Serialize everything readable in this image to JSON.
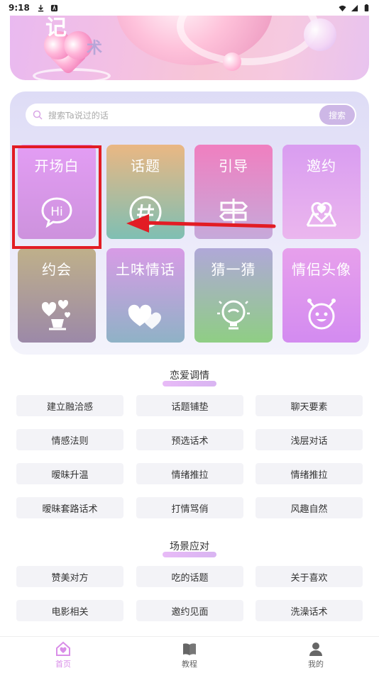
{
  "status_bar": {
    "time": "9:18"
  },
  "banner": {
    "glyph1": "记",
    "glyph2": "术"
  },
  "search": {
    "placeholder": "搜索Ta说过的话",
    "button": "搜索"
  },
  "tiles": [
    {
      "label": "开场白",
      "icon": "hi-bubble-icon",
      "color_top": "#e19cf3",
      "color_bottom": "#cf93df"
    },
    {
      "label": "话题",
      "icon": "hashtag-icon",
      "color_top": "#e8b783",
      "color_bottom": "#7fbfb3"
    },
    {
      "label": "引导",
      "icon": "signpost-icon",
      "color_top": "#f080c0",
      "color_bottom": "#c9a7d9"
    },
    {
      "label": "邀约",
      "icon": "map-heart-icon",
      "color_top": "#d99ff0",
      "color_bottom": "#e9b4ee"
    },
    {
      "label": "约会",
      "icon": "hearts-cup-icon",
      "color_top": "#bfb08c",
      "color_bottom": "#9d8aa8"
    },
    {
      "label": "土味情话",
      "icon": "two-hearts-icon",
      "color_top": "#d69be6",
      "color_bottom": "#92b0c6"
    },
    {
      "label": "猜一猜",
      "icon": "lightbulb-icon",
      "color_top": "#afa8d6",
      "color_bottom": "#8fcf86"
    },
    {
      "label": "情侣头像",
      "icon": "smiley-face-icon",
      "color_top": "#e8a1ec",
      "color_bottom": "#d48bf0"
    }
  ],
  "section1": {
    "title": "恋爱调情",
    "chips": [
      "建立融洽感",
      "话题铺垫",
      "聊天要素",
      "情感法则",
      "预选话术",
      "浅层对话",
      "暧昧升温",
      "情绪推拉",
      "情绪推拉",
      "暧昧套路话术",
      "打情骂俏",
      "风趣自然"
    ]
  },
  "section2": {
    "title": "场景应对",
    "chips": [
      "赞美对方",
      "吃的话题",
      "关于喜欢",
      "电影相关",
      "邀约见面",
      "洗澡话术"
    ]
  },
  "tabbar": {
    "items": [
      {
        "label": "首页",
        "icon": "home-heart-icon",
        "active": true
      },
      {
        "label": "教程",
        "icon": "book-icon",
        "active": false
      },
      {
        "label": "我的",
        "icon": "user-icon",
        "active": false
      }
    ]
  },
  "colors": {
    "accent": "#d98ee8",
    "highlight": "#e21c24",
    "chip_bg": "#f3f3f7"
  }
}
